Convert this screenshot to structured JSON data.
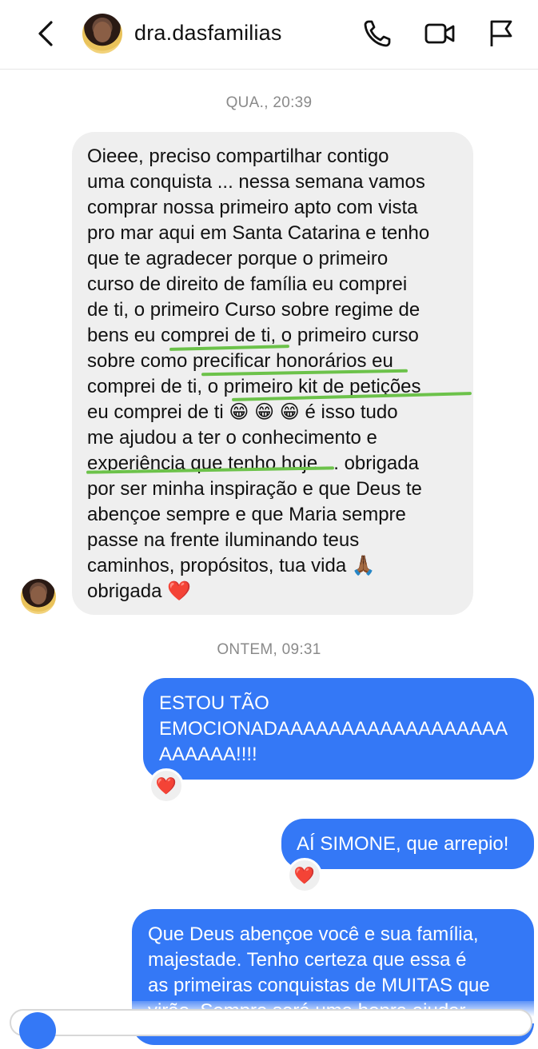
{
  "header": {
    "username": "dra.dasfamilias",
    "back_icon": "chevron-left-icon",
    "phone_icon": "phone-icon",
    "video_icon": "video-camera-icon",
    "flag_icon": "flag-icon"
  },
  "thread": {
    "stamp_1": "QUA., 20:39",
    "stamp_2": "ONTEM, 09:31",
    "incoming_message": "Oieee, preciso compartilhar contigo\numa conquista ... nessa semana vamos\ncomprar nossa primeiro apto com vista\npro mar aqui em Santa Catarina e tenho\nque te agradecer porque o primeiro\ncurso de direito de família eu comprei\nde ti, o primeiro Curso sobre regime de\nbens eu comprei de ti, o primeiro curso\nsobre como precificar honorários eu\ncomprei de ti, o primeiro kit de petições\neu comprei de ti 😁 😁 😁  é isso tudo\nme ajudou a ter o conhecimento e\nexperiência que tenho hoje ... obrigada\npor ser minha inspiração e que Deus te\nabençoe sempre e que Maria sempre\npasse na  frente iluminando teus\ncaminhos, propósitos, tua vida 🙏🏾\nobrigada ❤️",
    "outgoing_1": "ESTOU TÃO\nEMOCIONADAAAAAAAAAAAAAAAAAA\nAAAAAA!!!!",
    "outgoing_2": "AÍ SIMONE, que arrepio!",
    "outgoing_3": "Que Deus abençoe você e sua família,\nmajestade. Tenho certeza que essa é\nas primeiras conquistas de MUITAS que\nvirão. Sempre será uma honra ajudar",
    "reaction_1": "❤️",
    "reaction_2": "❤️"
  },
  "colors": {
    "outgoing_bubble": "#3478f6",
    "incoming_bubble": "#efefef",
    "highlight_underline": "#6cc24a"
  }
}
